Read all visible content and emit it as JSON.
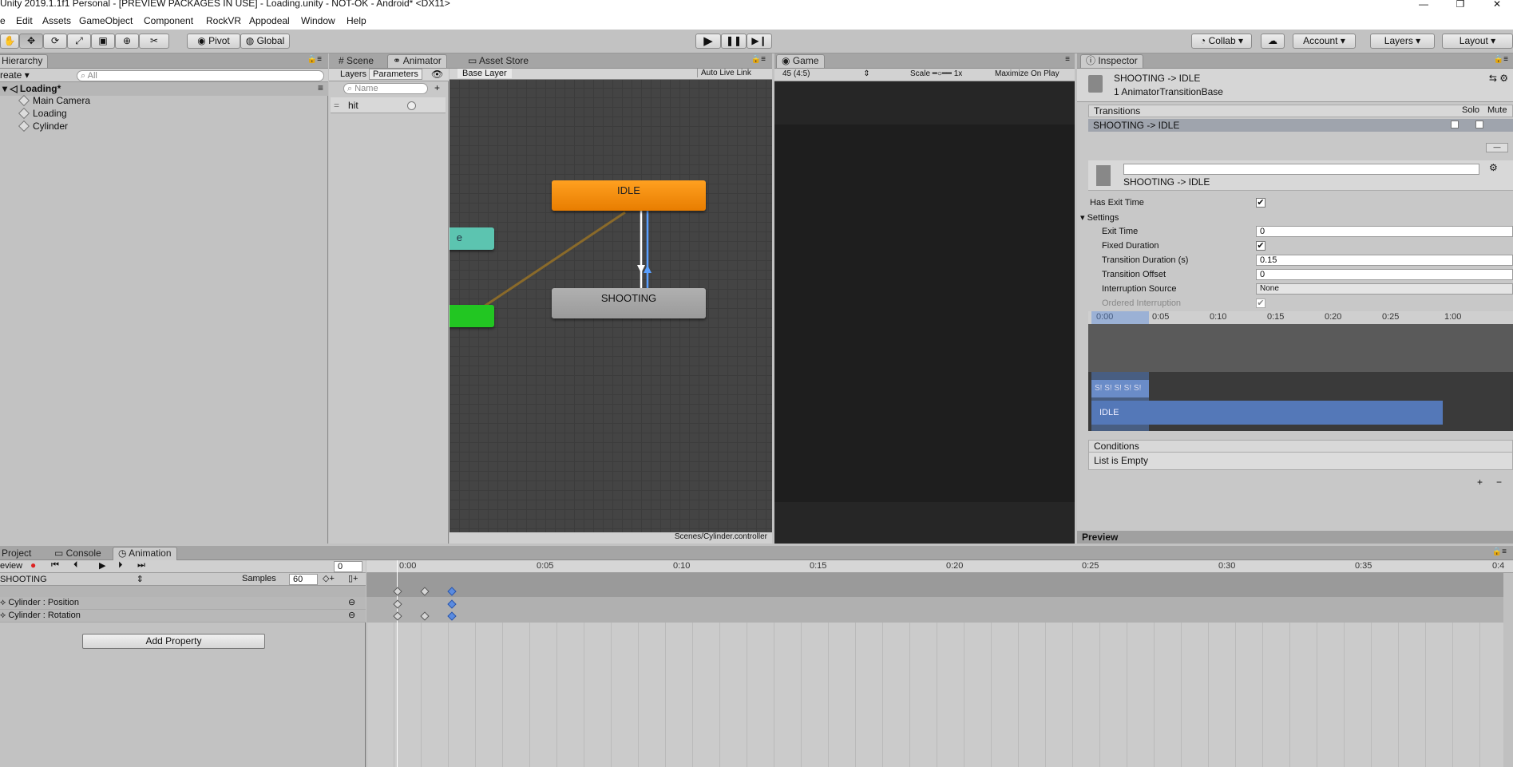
{
  "window": {
    "title": "Unity 2019.1.1f1 Personal - [PREVIEW PACKAGES IN USE] - Loading.unity - NOT-OK - Android* <DX11>",
    "minimize": "—",
    "maximize": "❐",
    "close": "✕"
  },
  "menu": [
    "e",
    "Edit",
    "Assets",
    "GameObject",
    "Component",
    "RockVR",
    "Appodeal",
    "Window",
    "Help"
  ],
  "toolbar": {
    "pivot": "Pivot",
    "global": "Global",
    "collab": "Collab",
    "account": "Account",
    "layers": "Layers",
    "layout": "Layout"
  },
  "hierarchy": {
    "tab": "Hierarchy",
    "create": "reate",
    "search_placeholder": "All",
    "scene": "Loading*",
    "items": [
      "Main Camera",
      "Loading",
      "Cylinder"
    ]
  },
  "animator": {
    "tabs": [
      "Scene",
      "Animator",
      "Asset Store"
    ],
    "subtabs": [
      "Layers",
      "Parameters"
    ],
    "search_placeholder": "Name",
    "param": "hit",
    "layer": "Base Layer",
    "live_link": "Auto Live Link",
    "nodes": {
      "idle": "IDLE",
      "shooting": "SHOOTING",
      "partial": "e"
    },
    "path": "Scenes/Cylinder.controller"
  },
  "game": {
    "tab": "Game",
    "aspect": "45 (4:5)",
    "scale": "Scale",
    "scale_value": "1x",
    "maximize": "Maximize On Play"
  },
  "inspector": {
    "tab": "Inspector",
    "title": "SHOOTING -> IDLE",
    "subtitle": "1 AnimatorTransitionBase",
    "transitions_header": "Transitions",
    "solo": "Solo",
    "mute": "Mute",
    "transition_item": "SHOOTING -> IDLE",
    "transition_name": "SHOOTING -> IDLE",
    "has_exit_time": "Has Exit Time",
    "settings": "Settings",
    "fields": [
      {
        "label": "Exit Time",
        "value": "0"
      },
      {
        "label": "Fixed Duration",
        "value": "✔"
      },
      {
        "label": "Transition Duration (s)",
        "value": "0.15"
      },
      {
        "label": "Transition Offset",
        "value": "0"
      },
      {
        "label": "Interruption Source",
        "value": "None"
      },
      {
        "label": "Ordered Interruption",
        "value": "✔"
      }
    ],
    "timeline_ticks": [
      "0:00",
      "0:05",
      "0:10",
      "0:15",
      "0:20",
      "0:25",
      "1:00"
    ],
    "track_src": "S! S! S! S! S!",
    "track_dst": "IDLE",
    "conditions": "Conditions",
    "conditions_empty": "List is Empty",
    "preview": "Preview"
  },
  "bottom": {
    "tabs": [
      "Project",
      "Console",
      "Animation"
    ],
    "preview": "eview",
    "frame": "0",
    "clip": "SHOOTING",
    "samples_label": "Samples",
    "samples": "60",
    "properties": [
      "Cylinder : Position",
      "Cylinder : Rotation"
    ],
    "add_property": "Add Property",
    "ruler": [
      "0:00",
      "0:05",
      "0:10",
      "0:15",
      "0:20",
      "0:25",
      "0:30",
      "0:35",
      "0:4"
    ]
  }
}
